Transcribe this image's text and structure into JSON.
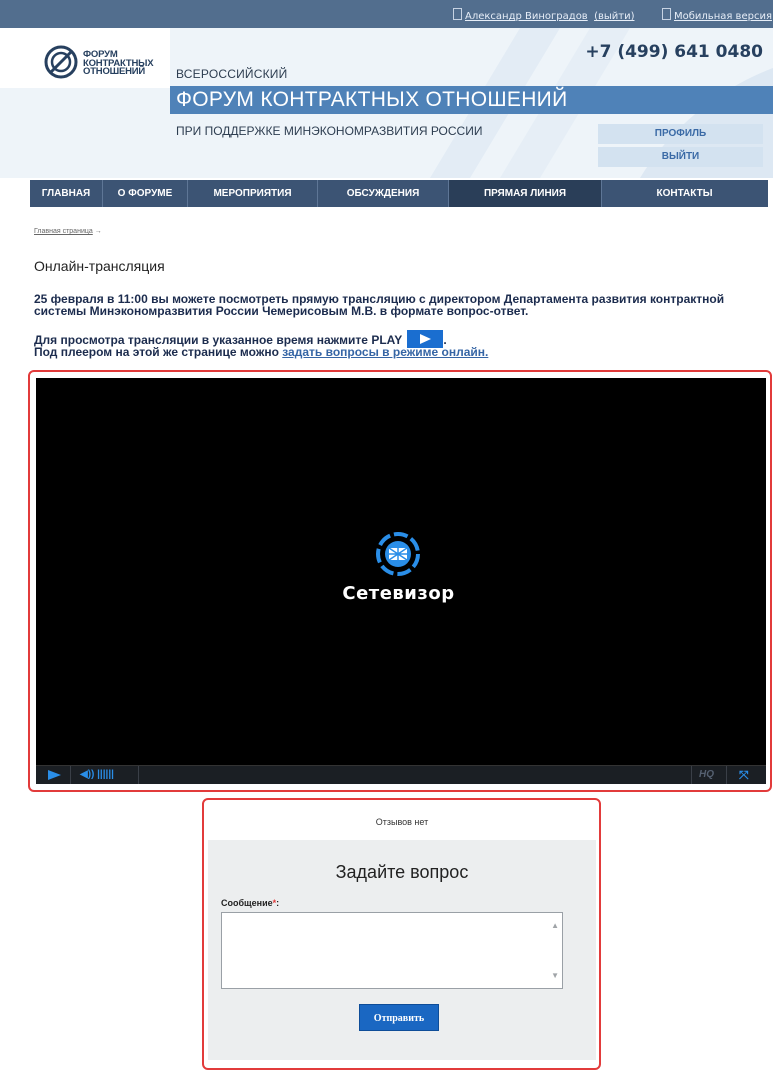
{
  "topbar": {
    "user_name": "Александр Виноградов",
    "logout_link": "(выйти)",
    "mobile_link": "Мобильная версия"
  },
  "header": {
    "logo_line1": "ФОРУМ",
    "logo_line2": "КОНТРАКТНЫХ",
    "logo_line3": "ОТНОШЕНИЙ",
    "phone": "+7 (499) 641 0480",
    "pre_title": "ВСЕРОССИЙСКИЙ",
    "title": "ФОРУМ КОНТРАКТНЫХ ОТНОШЕНИЙ",
    "subtitle": "ПРИ ПОДДЕРЖКЕ МИНЭКОНОМРАЗВИТИЯ РОССИИ",
    "profile_button": "ПРОФИЛЬ",
    "logout_button": "ВЫЙТИ"
  },
  "nav": {
    "items": [
      {
        "label": "ГЛАВНАЯ"
      },
      {
        "label": "О ФОРУМЕ"
      },
      {
        "label": "МЕРОПРИЯТИЯ"
      },
      {
        "label": "ОБСУЖДЕНИЯ"
      },
      {
        "label": "ПРЯМАЯ ЛИНИЯ"
      },
      {
        "label": "КОНТАКТЫ"
      }
    ],
    "active": "ПРЯМАЯ ЛИНИЯ"
  },
  "breadcrumb": {
    "home": "Главная страница",
    "arrow": "→"
  },
  "page_title": "Онлайн-трансляция",
  "info": {
    "line1": "25 февраля в 11:00 вы можете посмотреть прямую трансляцию с директором Департамента развития контрактной системы Минэкономразвития России Чемерисовым М.В. в формате вопрос-ответ.",
    "line2": "Для просмотра трансляции в указанное время нажмите PLAY",
    "line2_end": ".",
    "line3_prefix": "Под плеером на этой же странице можно ",
    "line3_link": "задать вопросы в режиме онлайн."
  },
  "player": {
    "brand": "Сетевизор",
    "hq_label": "HQ",
    "volume_icon": "speaker-icon",
    "fullscreen_icon": "fullscreen-icon"
  },
  "comments": {
    "no_reviews": "Отзывов нет",
    "ask_title": "Задайте вопрос",
    "message_label": "Сообщение",
    "required_mark": "*",
    "label_colon": ":",
    "message_value": "",
    "submit_label": "Отправить"
  },
  "colors": {
    "topbar": "#526e8e",
    "nav": "#3c5474",
    "nav_active": "#2a3e58",
    "header_band": "#4f82b8",
    "accent_blue": "#1a67c2",
    "highlight_red": "#e23b3b"
  }
}
